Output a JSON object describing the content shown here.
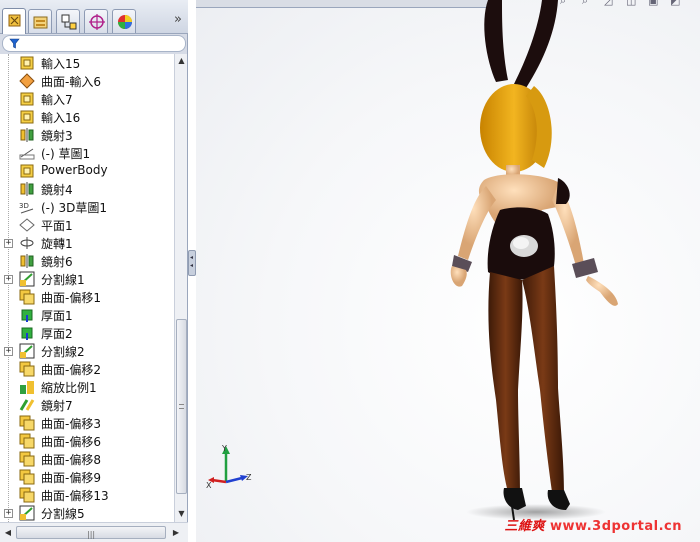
{
  "panel": {
    "tabs": [
      {
        "name": "feature-manager",
        "icon": "feature-tree-icon",
        "active": true
      },
      {
        "name": "property-manager",
        "icon": "property-manager-icon"
      },
      {
        "name": "configuration-manager",
        "icon": "configuration-manager-icon"
      },
      {
        "name": "dimxpert-manager",
        "icon": "crosshair-icon"
      },
      {
        "name": "display-manager",
        "icon": "appearance-sphere-icon"
      }
    ],
    "expand_glyph": "»",
    "filter_icon": "funnel-icon"
  },
  "tree": {
    "items": [
      {
        "label": "輸入15",
        "icon": "import-icon",
        "expandable": false
      },
      {
        "label": "曲面-輸入6",
        "icon": "surface-import-icon",
        "expandable": false
      },
      {
        "label": "輸入7",
        "icon": "import-icon",
        "expandable": false
      },
      {
        "label": "輸入16",
        "icon": "import-icon",
        "expandable": false
      },
      {
        "label": "鏡射3",
        "icon": "mirror-icon",
        "expandable": false
      },
      {
        "label": "(-) 草圖1",
        "icon": "sketch-icon",
        "expandable": false
      },
      {
        "label": "PowerBody",
        "icon": "import-icon",
        "expandable": false
      },
      {
        "label": "鏡射4",
        "icon": "mirror-icon",
        "expandable": false
      },
      {
        "label": "(-) 3D草圖1",
        "icon": "3d-sketch-icon",
        "expandable": false
      },
      {
        "label": "平面1",
        "icon": "plane-icon",
        "expandable": false
      },
      {
        "label": "旋轉1",
        "icon": "revolve-icon",
        "expandable": true
      },
      {
        "label": "鏡射6",
        "icon": "mirror-icon",
        "expandable": false
      },
      {
        "label": "分割線1",
        "icon": "split-line-icon",
        "expandable": true
      },
      {
        "label": "曲面-偏移1",
        "icon": "surface-offset-icon",
        "expandable": false
      },
      {
        "label": "厚面1",
        "icon": "thicken-icon",
        "expandable": false
      },
      {
        "label": "厚面2",
        "icon": "thicken-icon",
        "expandable": false
      },
      {
        "label": "分割線2",
        "icon": "split-line-icon",
        "expandable": true
      },
      {
        "label": "曲面-偏移2",
        "icon": "surface-offset-icon",
        "expandable": false
      },
      {
        "label": "縮放比例1",
        "icon": "scale-icon",
        "expandable": false
      },
      {
        "label": "鏡射7",
        "icon": "mirror-body-icon",
        "expandable": false
      },
      {
        "label": "曲面-偏移3",
        "icon": "surface-offset-icon",
        "expandable": false
      },
      {
        "label": "曲面-偏移6",
        "icon": "surface-offset-icon",
        "expandable": false
      },
      {
        "label": "曲面-偏移8",
        "icon": "surface-offset-icon",
        "expandable": false
      },
      {
        "label": "曲面-偏移9",
        "icon": "surface-offset-icon",
        "expandable": false
      },
      {
        "label": "曲面-偏移13",
        "icon": "surface-offset-icon",
        "expandable": false
      },
      {
        "label": "分割線5",
        "icon": "split-line-icon",
        "expandable": true
      }
    ]
  },
  "scroll": {
    "vertical_up": "▲",
    "vertical_down": "▼",
    "horizontal_left": "◀",
    "horizontal_right": "▶",
    "grip": "≡",
    "hgrip": "|||"
  },
  "viewport": {
    "model": "bunny-girl-character-model",
    "triad_labels": {
      "x": "X",
      "y": "Y",
      "z": "Z"
    },
    "watermark_cn": "三維爽",
    "watermark_url": "www.3dportal.cn"
  },
  "colors": {
    "hair": "#e0a010",
    "skin": "#f2c79a",
    "outfit": "#1a0c0c",
    "stockings": "#5a2a12",
    "accent_red": "#dd2222"
  }
}
